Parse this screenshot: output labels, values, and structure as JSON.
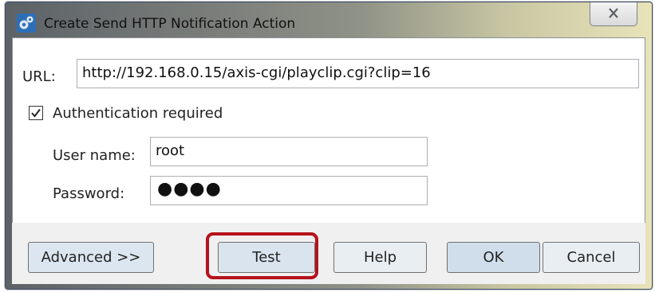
{
  "window": {
    "title": "Create Send HTTP Notification Action",
    "icon": "gear-icon",
    "close_icon": "close-icon"
  },
  "form": {
    "url_label": "URL:",
    "url_value": "http://192.168.0.15/axis-cgi/playclip.cgi?clip=16",
    "auth_checked": true,
    "auth_label": "Authentication required",
    "username_label": "User name:",
    "username_value": "root",
    "password_label": "Password:",
    "password_value": "●●●●"
  },
  "buttons": {
    "advanced": "Advanced >>",
    "test": "Test",
    "help": "Help",
    "ok": "OK",
    "cancel": "Cancel"
  },
  "colors": {
    "highlight": "#b5121b"
  }
}
